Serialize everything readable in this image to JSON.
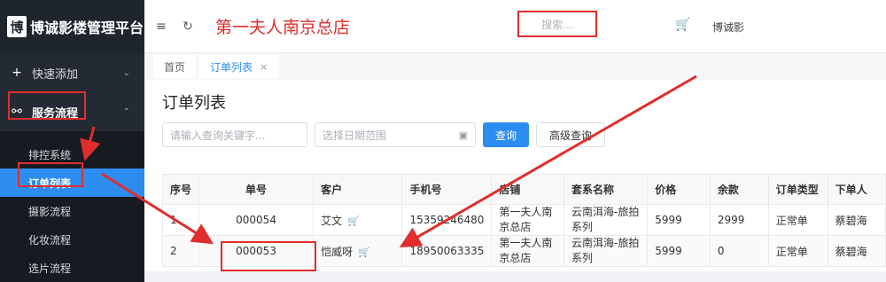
{
  "app": {
    "logo_char": "博",
    "name": "博诚影楼管理平台"
  },
  "header": {
    "store_title": "第一夫人南京总店",
    "search_placeholder": "搜索...",
    "user": "博诚影"
  },
  "sidebar": {
    "quick_add": "快速添加",
    "service_flow": "服务流程",
    "sub_items": [
      "排控系统",
      "订单列表",
      "摄影流程",
      "化妆流程",
      "选片流程"
    ]
  },
  "tabs": [
    {
      "label": "首页"
    },
    {
      "label": "订单列表",
      "close": "×"
    }
  ],
  "main": {
    "title": "订单列表",
    "keyword_placeholder": "请输入查询关键字...",
    "date_placeholder": "选择日期范围",
    "query_button": "查询",
    "advanced_button": "高级查询"
  },
  "table": {
    "columns": [
      "序号",
      "单号",
      "客户",
      "手机号",
      "店铺",
      "套系名称",
      "价格",
      "余款",
      "订单类型",
      "下单人"
    ],
    "rows": [
      {
        "idx": "1",
        "order_no": "000054",
        "customer": "艾文",
        "phone": "15359246480",
        "store": "第一夫人南京总店",
        "package": "云南洱海-旅拍系列",
        "price": "5999",
        "balance": "2999",
        "type": "正常单",
        "creator": "蔡碧海"
      },
      {
        "idx": "2",
        "order_no": "000053",
        "customer": "恺威呀",
        "phone": "18950063335",
        "store": "第一夫人南京总店",
        "package": "云南洱海-旅拍系列",
        "price": "5999",
        "balance": "0",
        "type": "正常单",
        "creator": "蔡碧海"
      }
    ]
  },
  "colors": {
    "accent": "#2d8cf0",
    "annotation": "#e02d2d",
    "sidebar_bg": "#242a33"
  }
}
